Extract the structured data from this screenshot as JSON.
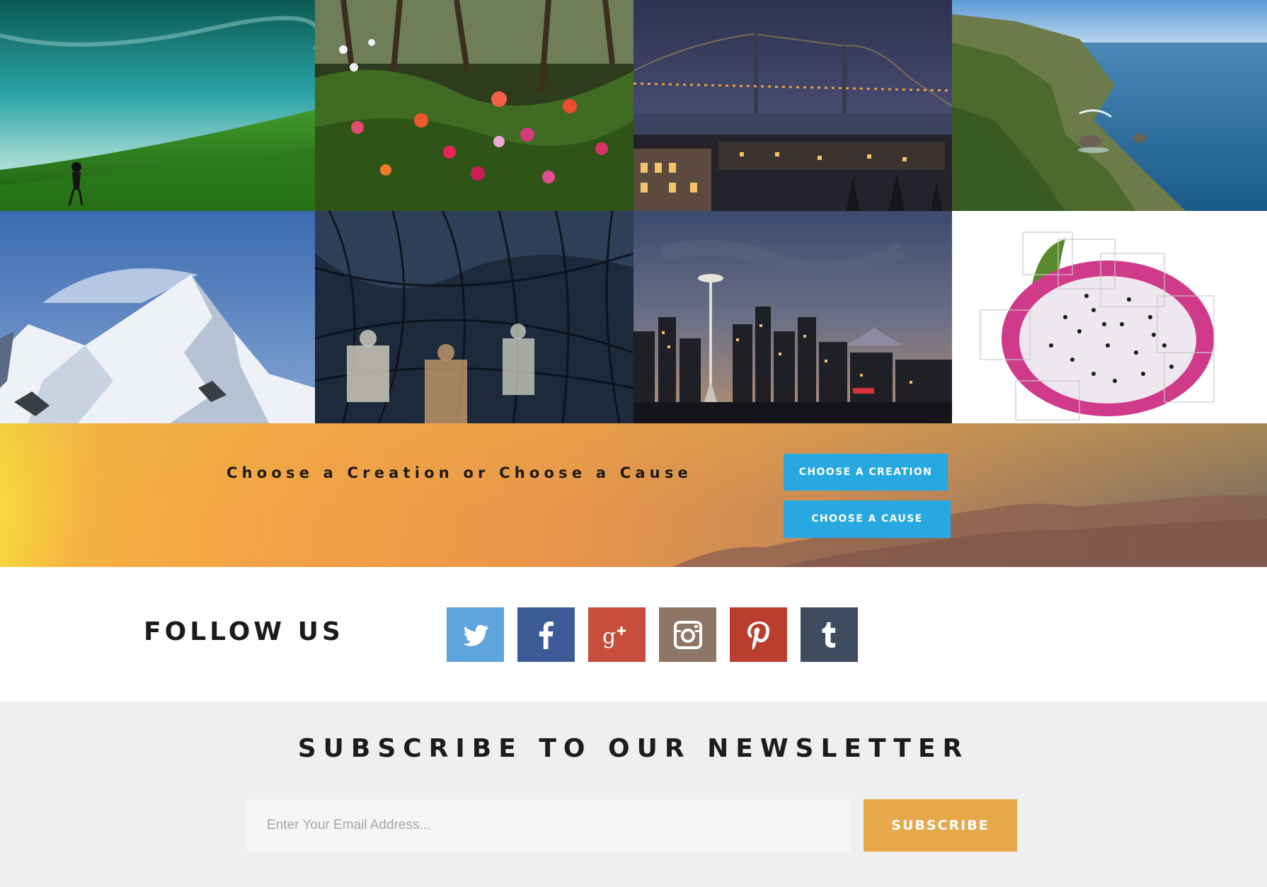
{
  "gallery": {
    "tiles": [
      {
        "subject": "green-hillside-photo"
      },
      {
        "subject": "flower-garden-photo"
      },
      {
        "subject": "bay-bridge-night-photo"
      },
      {
        "subject": "coastline-photo"
      },
      {
        "subject": "snowy-mountain-photo"
      },
      {
        "subject": "forest-projection-photo"
      },
      {
        "subject": "seattle-skyline-photo"
      },
      {
        "subject": "dragon-fruit-photo"
      }
    ]
  },
  "cta": {
    "text": "Choose a Creation or Choose a Cause",
    "creation_button": "CHOOSE A CREATION",
    "cause_button": "CHOOSE A CAUSE",
    "button_color": "#27a8e0"
  },
  "follow": {
    "title": "FOLLOW US",
    "networks": [
      {
        "icon": "twitter-icon",
        "color": "#5fa5dc"
      },
      {
        "icon": "facebook-icon",
        "color": "#3c5a96"
      },
      {
        "icon": "google-plus-icon",
        "color": "#c84e3c"
      },
      {
        "icon": "instagram-icon",
        "color": "#8e7666"
      },
      {
        "icon": "pinterest-icon",
        "color": "#ba3d2e"
      },
      {
        "icon": "tumblr-icon",
        "color": "#3f4b5f"
      }
    ]
  },
  "newsletter": {
    "title": "SUBSCRIBE TO OUR NEWSLETTER",
    "email_placeholder": "Enter Your Email Address...",
    "subscribe_label": "SUBSCRIBE",
    "subscribe_color": "#e7a84c"
  }
}
